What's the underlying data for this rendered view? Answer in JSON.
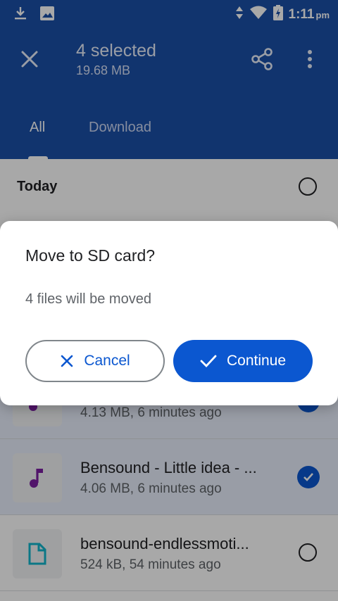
{
  "status_bar": {
    "time": "1:11",
    "ampm": "pm"
  },
  "app_bar": {
    "title": "4 selected",
    "subtitle": "19.68 MB"
  },
  "tabs": [
    {
      "label": "All"
    },
    {
      "label": "Download"
    }
  ],
  "section": {
    "label": "Today"
  },
  "files": [
    {
      "name": "",
      "meta": "4.13 MB, 6 minutes ago",
      "type": "audio",
      "selected": true
    },
    {
      "name": "Bensound - Little idea - ...",
      "meta": "4.06 MB, 6 minutes ago",
      "type": "audio",
      "selected": true
    },
    {
      "name": "bensound-endlessmoti...",
      "meta": "524 kB, 54 minutes ago",
      "type": "document",
      "selected": false
    }
  ],
  "dialog": {
    "title": "Move to SD card?",
    "body": "4 files will be moved",
    "cancel_label": "Cancel",
    "continue_label": "Continue"
  },
  "colors": {
    "primary": "#1b4fa8",
    "accent": "#0b57d0",
    "audio_icon": "#7b1fa2",
    "doc_icon": "#12b5cb"
  }
}
